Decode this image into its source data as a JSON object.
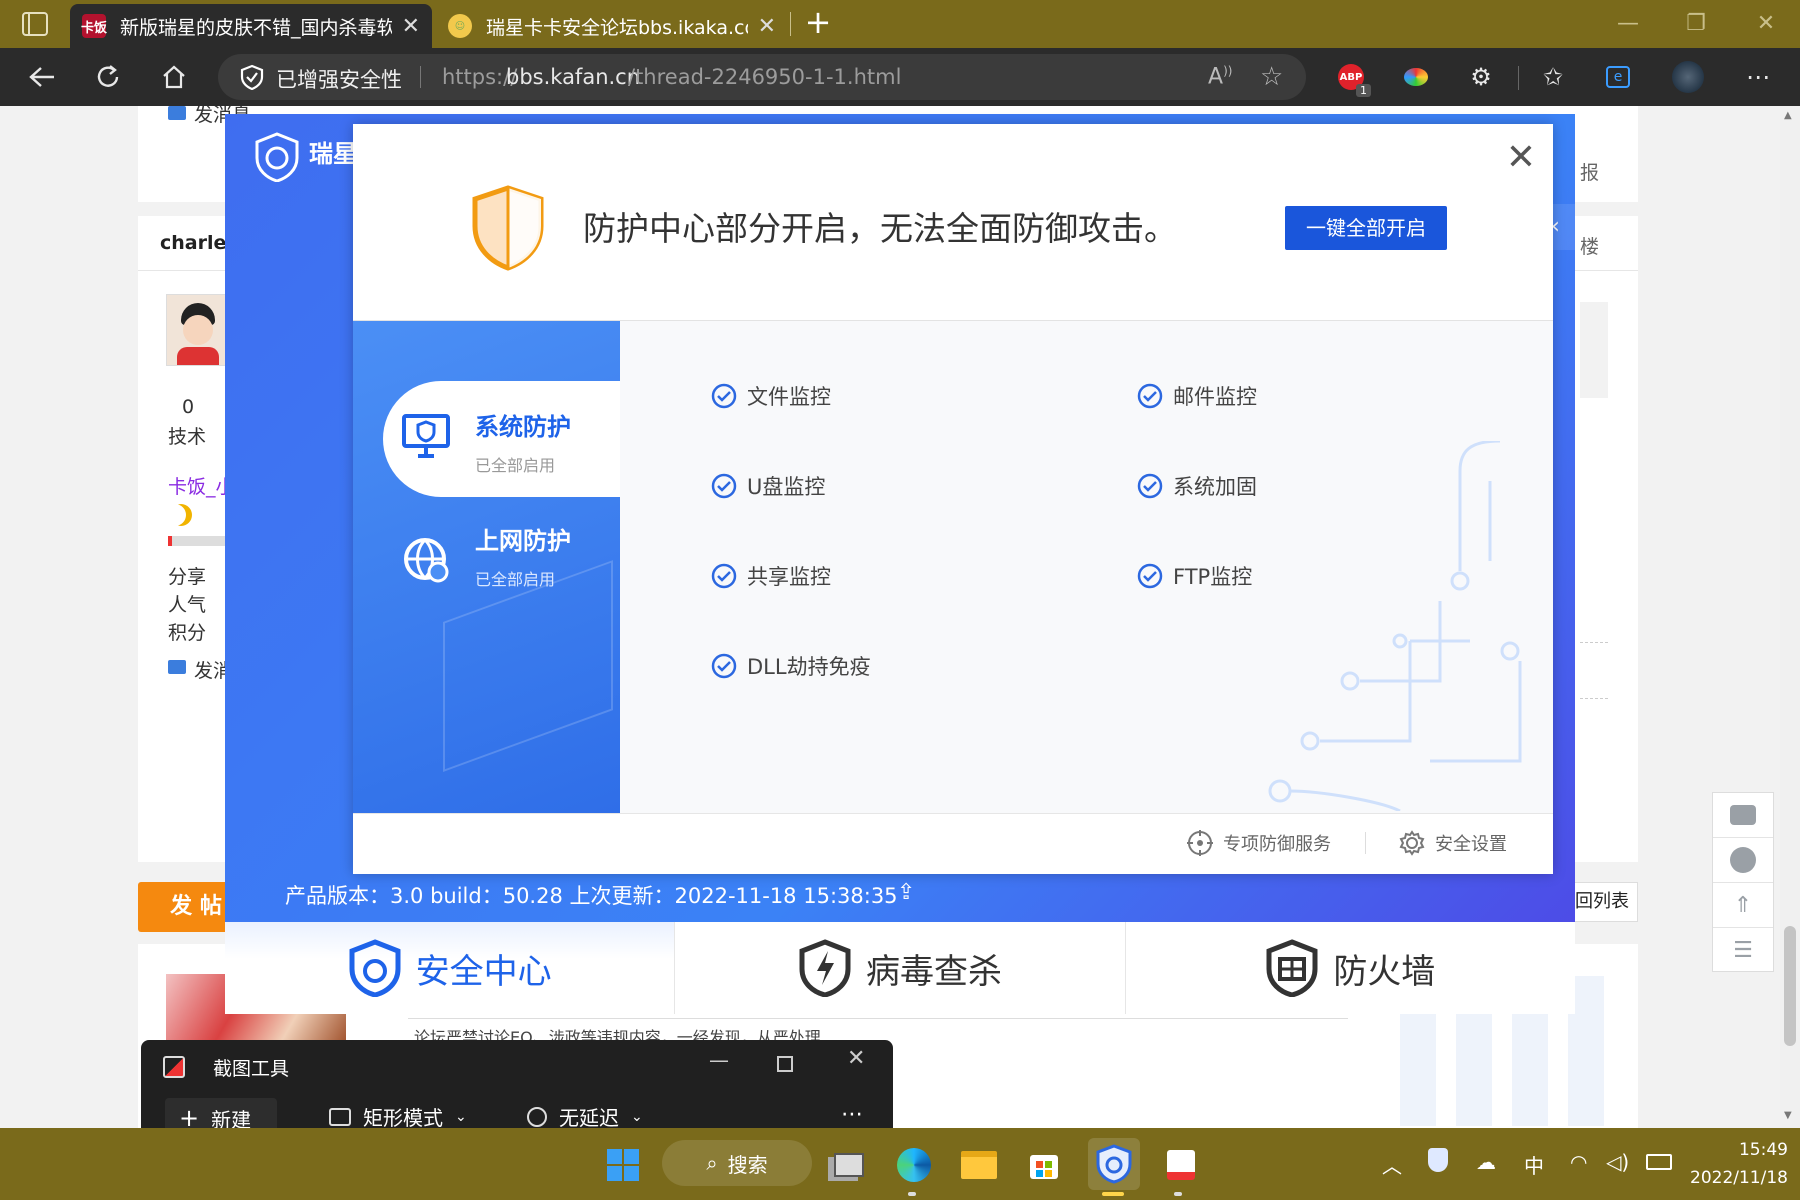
{
  "browser": {
    "tabs": [
      {
        "title": "新版瑞星的皮肤不错_国内杀毒软",
        "favicon": "卡饭"
      },
      {
        "title": "瑞星卡卡安全论坛bbs.ikaka.com",
        "favicon": "ikaka"
      }
    ],
    "security_label": "已增强安全性",
    "url_prefix": "https://",
    "url_host": "bbs.kafan.cn",
    "url_path": "/thread-2246950-1-1.html",
    "abp_badge": "1"
  },
  "forum": {
    "send_msg": "发消息",
    "username": "charles",
    "stats_num": "0",
    "stats_label": "技术",
    "rank_name": "卡饭_小",
    "stat_labels": [
      "分享",
      "人气",
      "积分"
    ],
    "send_msg2": "发消",
    "post_button": "发 帖",
    "report": "报",
    "floor": "楼",
    "back_list": "回列表",
    "notice": "论坛严禁讨论EQ、涉政等违规内容，一经发现，从严处理"
  },
  "rising": {
    "brand": "瑞星",
    "warning": "防护中心部分开启，无法全面防御攻击。",
    "enable_all": "一键全部开启",
    "nav": [
      {
        "title": "系统防护",
        "sub": "已全部启用"
      },
      {
        "title": "上网防护",
        "sub": "已全部启用"
      }
    ],
    "features_left": [
      "文件监控",
      "U盘监控",
      "共享监控",
      "DLL劫持免疫"
    ],
    "features_right": [
      "邮件监控",
      "系统加固",
      "FTP监控"
    ],
    "footer_service": "专项防御服务",
    "footer_settings": "安全设置",
    "version_line": "产品版本：3.0  build：50.28   上次更新：2022-11-18 15:38:35",
    "bottom_tabs": [
      "安全中心",
      "病毒查杀",
      "防火墙"
    ]
  },
  "snip": {
    "title": "截图工具",
    "new": "新建",
    "mode": "矩形模式",
    "delay": "无延迟"
  },
  "taskbar": {
    "search": "搜索",
    "ime": "中",
    "time": "15:49",
    "date": "2022/11/18"
  },
  "colors": {
    "accent_blue": "#1a56db",
    "taskbar": "#7a6a1b",
    "post_orange": "#f5890f",
    "check_blue": "#2c68e0"
  }
}
